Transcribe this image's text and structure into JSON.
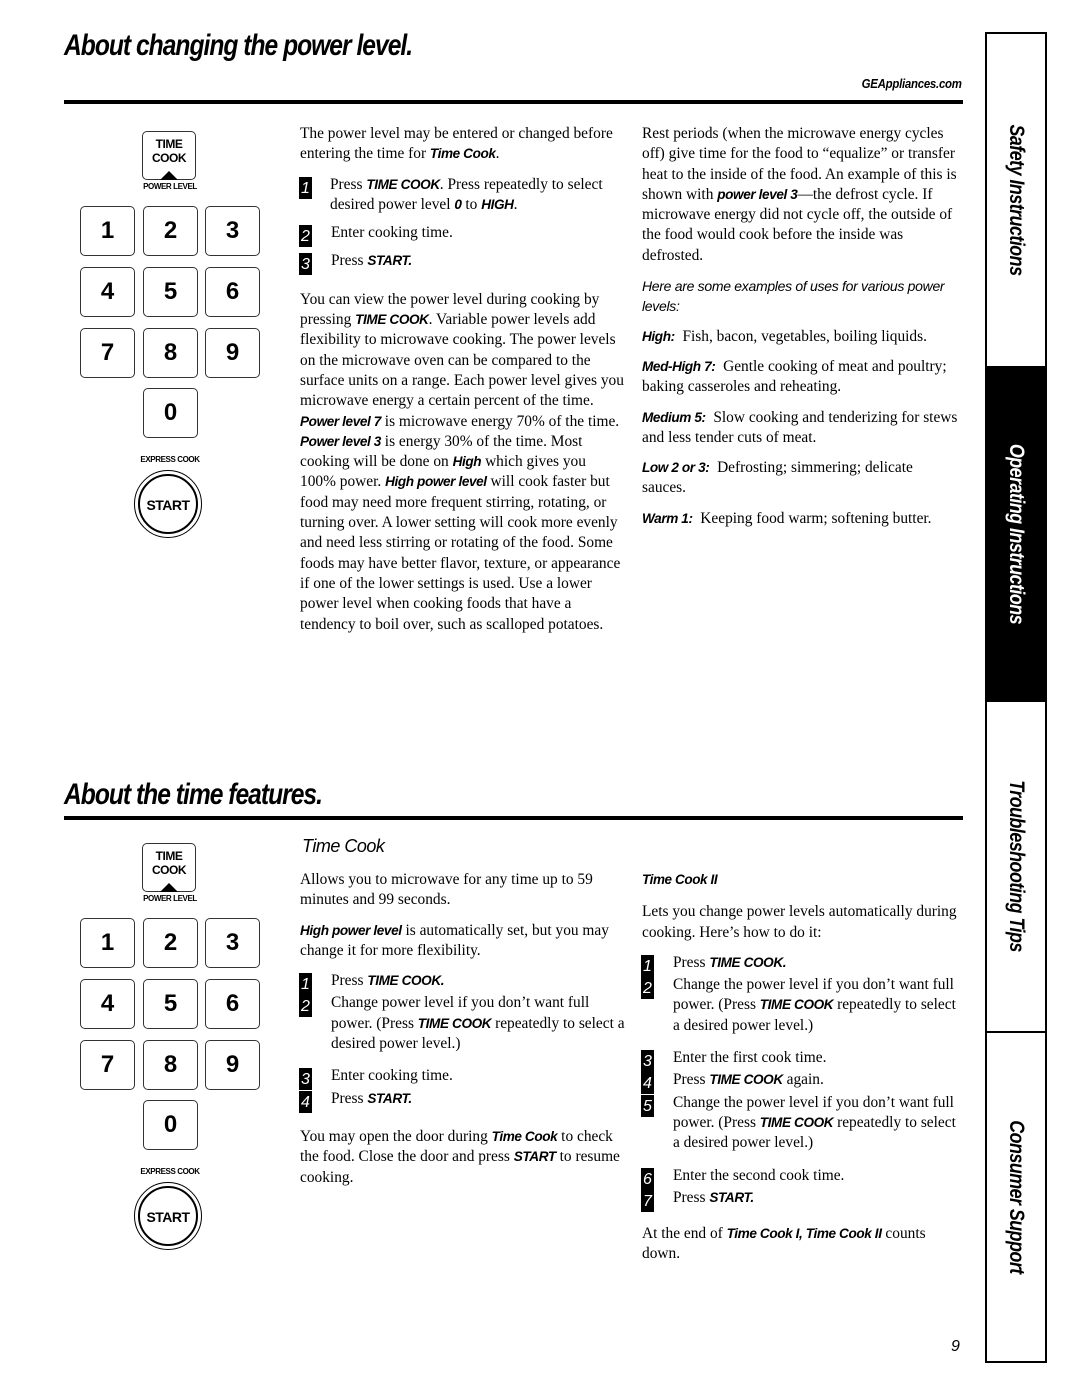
{
  "header": {
    "title": "About changing the power level.",
    "site": "GEAppliances.com"
  },
  "keypad": {
    "time_cook_line1": "TIME",
    "time_cook_line2": "COOK",
    "power_level_label": "POWER LEVEL",
    "digits": [
      "1",
      "2",
      "3",
      "4",
      "5",
      "6",
      "7",
      "8",
      "9",
      "0"
    ],
    "express_cook_label": "EXPRESS COOK",
    "start_label": "START"
  },
  "power": {
    "intro": {
      "text": "The power level may be entered or changed before entering the time for ",
      "em": "Time Cook",
      "end": "."
    },
    "steps": [
      {
        "num": "1",
        "pre": "Press ",
        "em1": "TIME COOK",
        "mid": ". Press repeatedly to select desired power level ",
        "em2": "0",
        "mid2": " to ",
        "em3": "HIGH",
        "end": "."
      },
      {
        "num": "2",
        "text": "Enter cooking time."
      },
      {
        "num": "3",
        "pre": "Press ",
        "em": "START."
      }
    ],
    "body": {
      "p1": "You can view the power level during cooking by pressing ",
      "em1": "TIME COOK",
      "p2": ". Variable power levels add flexibility to microwave cooking. The power levels on the microwave oven can be compared to the surface units on a range. Each power level gives you microwave energy a certain percent of the time. ",
      "em2": "Power level 7",
      "p3": " is microwave energy 70% of the time. ",
      "em3": "Power level 3",
      "p4": " is energy 30% of the time. Most cooking will be done on ",
      "em4": "High",
      "p5": " which gives you 100% power. ",
      "em5": "High power level",
      "p6": " will cook faster but food may need more frequent stirring, rotating, or turning over. A lower setting will cook more evenly and need less stirring or rotating of the food. Some foods may have better flavor, texture, or appearance if one of the lower settings is used. Use a lower power level when cooking foods that have a tendency to boil over, such as scalloped potatoes."
    },
    "rest": {
      "p1": "Rest periods (when the microwave energy cycles off) give time for the food to “equalize” or transfer heat to the inside of the food. An example of this is shown with ",
      "em": "power level 3",
      "p2": "—the defrost cycle. If microwave energy did not cycle off, the outside of the food would cook before the inside was defrosted."
    },
    "examples_intro": "Here are some examples of uses for various power levels:",
    "examples": [
      {
        "label": "High:",
        "text": "Fish, bacon, vegetables, boiling liquids."
      },
      {
        "label": "Med-High 7:",
        "text": "Gentle cooking of meat and poultry; baking casseroles and reheating."
      },
      {
        "label": "Medium 5:",
        "text": "Slow cooking and tenderizing for stews and less tender cuts of meat."
      },
      {
        "label": "Low 2 or 3:",
        "text": "Defrosting; simmering; delicate sauces."
      },
      {
        "label": "Warm 1:",
        "text": "Keeping food warm; softening butter."
      }
    ]
  },
  "time": {
    "title": "About the time features.",
    "time_cook": {
      "heading": "Time Cook",
      "intro": "Allows you to microwave for any time up to 59 minutes and 99 seconds.",
      "high_em": "High power level",
      "high_text": " is automatically set, but you may change it for more flexibility.",
      "steps": [
        {
          "num": "1",
          "pre": "Press ",
          "em": "TIME COOK.",
          "post": ""
        },
        {
          "num": "2",
          "pre": "Change power level if you don’t want full power. (Press ",
          "em": "TIME COOK",
          "post": " repeatedly to select a desired power level.)"
        },
        {
          "num": "3",
          "pre": "Enter cooking time.",
          "em": "",
          "post": ""
        },
        {
          "num": "4",
          "pre": "Press ",
          "em": "START.",
          "post": ""
        }
      ],
      "door": {
        "p1": "You may open the door during ",
        "em1": "Time Cook",
        "p2": " to check the food. Close the door and press ",
        "em2": "START",
        "p3": " to resume cooking."
      }
    },
    "time_cook_2": {
      "heading": "Time Cook II",
      "intro": "Lets you change power levels automatically during cooking. Here’s how to do it:",
      "steps": [
        {
          "num": "1",
          "pre": "Press ",
          "em": "TIME COOK.",
          "post": ""
        },
        {
          "num": "2",
          "pre": "Change the power level if you don’t want full power. (Press ",
          "em": "TIME COOK",
          "post": " repeatedly to select a desired power level.)"
        },
        {
          "num": "3",
          "pre": "Enter the first cook time.",
          "em": "",
          "post": ""
        },
        {
          "num": "4",
          "pre": "Press ",
          "em": "TIME COOK",
          "post": "  again."
        },
        {
          "num": "5",
          "pre": "Change the power level if you don’t want full power. (Press ",
          "em": "TIME COOK",
          "post": " repeatedly to select a desired power level.)"
        },
        {
          "num": "6",
          "pre": "Enter the second cook time.",
          "em": "",
          "post": ""
        },
        {
          "num": "7",
          "pre": "Press ",
          "em": "START.",
          "post": ""
        }
      ],
      "end": {
        "p1": "At the end of ",
        "em": "Time Cook I, Time Cook II",
        "p2": " counts down."
      }
    }
  },
  "side_tabs": [
    {
      "label": "Safety Instructions",
      "active": false
    },
    {
      "label": "Operating Instructions",
      "active": true
    },
    {
      "label": "Troubleshooting Tips",
      "active": false
    },
    {
      "label": "Consumer Support",
      "active": false
    }
  ],
  "page_number": "9"
}
